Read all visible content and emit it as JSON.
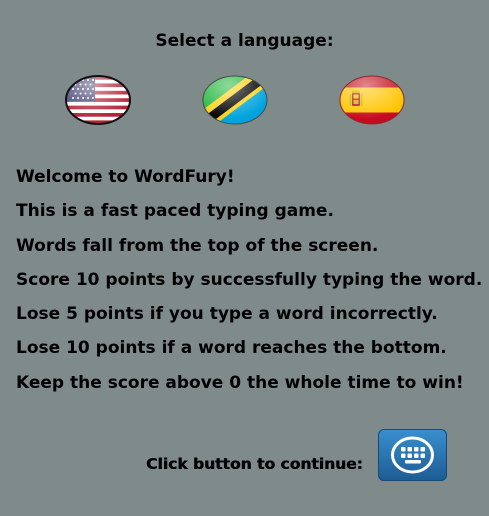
{
  "language_prompt": "Select a language:",
  "languages": [
    {
      "name": "us-flag-icon",
      "colors": {
        "red": "#b22234",
        "white": "#ffffff",
        "blue": "#3c3b6e"
      }
    },
    {
      "name": "tanzania-flag-icon",
      "colors": {
        "green": "#1eb53a",
        "yellow": "#fcd116",
        "black": "#000000",
        "blue": "#00a3dd"
      }
    },
    {
      "name": "spain-flag-icon",
      "colors": {
        "red": "#c60b1e",
        "yellow": "#ffc400"
      }
    }
  ],
  "instructions": [
    "Welcome to WordFury!",
    "This is a fast paced typing game.",
    "Words fall from the top of the screen.",
    "Score 10 points by successfully typing the word.",
    "Lose 5 points if you type a word incorrectly.",
    "Lose 10 points if a word reaches the bottom.",
    "Keep the score above 0 the whole time to win!"
  ],
  "continue_label": "Click button to continue:",
  "continue_icon": "grid-icon",
  "colors": {
    "background": "#7f8b8b",
    "button": "#2a74b3"
  }
}
